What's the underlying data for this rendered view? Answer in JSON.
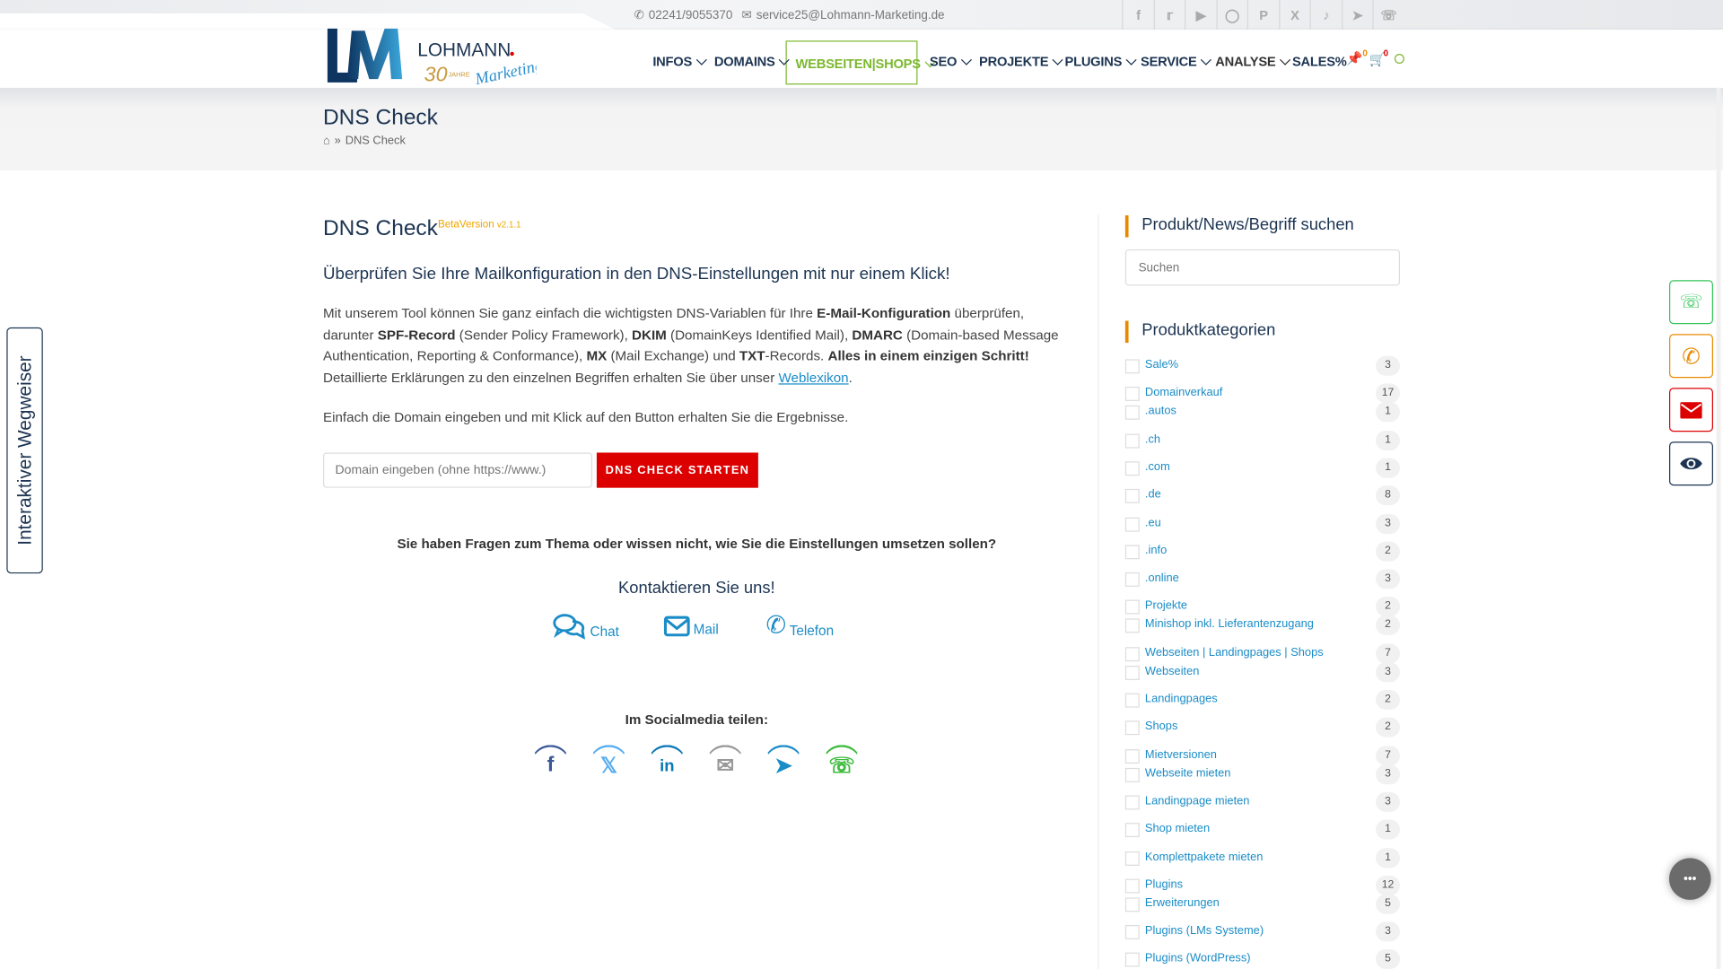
{
  "topbar": {
    "phone": "02241/9055370",
    "email": "service25@Lohmann-Marketing.de",
    "social_icons": [
      "facebook-icon",
      "twitter-icon",
      "youtube-icon",
      "instagram-icon",
      "pinterest-icon",
      "xing-icon",
      "tiktok-icon",
      "telegram-icon",
      "whatsapp-icon"
    ]
  },
  "logo": {
    "text": "LOHMANN.",
    "sub": "30",
    "jahre": "JAHRE",
    "marketing": "Marketing"
  },
  "nav": {
    "items": [
      {
        "label": "INFOS",
        "dropdown": true
      },
      {
        "label": "DOMAINS",
        "dropdown": true
      },
      {
        "label": "WEBSEITEN|SHOPS",
        "dropdown": true,
        "active": true
      },
      {
        "label": "SEO",
        "dropdown": true
      },
      {
        "label": "PROJEKTE",
        "dropdown": true
      },
      {
        "label": "PLUGINS",
        "dropdown": true
      },
      {
        "label": "SERVICE",
        "dropdown": true
      },
      {
        "label": "ANALYSE",
        "dropdown": true
      },
      {
        "label": "SALES%",
        "dropdown": false
      }
    ],
    "pin_count": "0",
    "cart_count": "0"
  },
  "page_header": {
    "title": "DNS Check",
    "breadcrumb_current": "DNS Check"
  },
  "main": {
    "title": "DNS Check",
    "beta": "BetaVersion",
    "version": "v2.1.1",
    "subtitle": "Überprüfen Sie Ihre Mailkonfiguration in den DNS-Einstellungen mit nur einem Klick!",
    "intro": [
      {
        "t": "Mit unserem Tool können Sie ganz einfach die wichtigsten DNS-Variablen für Ihre "
      },
      {
        "t": "E-Mail-Konfiguration",
        "b": true
      },
      {
        "t": " überprüfen, darunter "
      },
      {
        "t": "SPF-Record",
        "b": true
      },
      {
        "t": " (Sender Policy Framework), "
      },
      {
        "t": "DKIM",
        "b": true
      },
      {
        "t": " (DomainKeys Identified Mail), "
      },
      {
        "t": "DMARC",
        "b": true
      },
      {
        "t": " (Domain-based Message Authentication, Reporting & Conformance), "
      },
      {
        "t": "MX",
        "b": true
      },
      {
        "t": " (Mail Exchange) und "
      },
      {
        "t": "TXT",
        "b": true
      },
      {
        "t": "-Records. "
      },
      {
        "t": "Alles in einem einzigen Schritt!",
        "b": true
      }
    ],
    "explain_prefix": "Detaillierte Erklärungen zu den einzelnen Begriffen erhalten Sie über unser ",
    "explain_link": "Weblexikon",
    "explain_suffix": ".",
    "instruction": "Einfach die Domain eingeben und mit Klick auf den Button erhalten Sie die Ergebnisse.",
    "domain_placeholder": "Domain eingeben (ohne https://www.)",
    "domain_value": "",
    "check_button": "DNS CHECK STARTEN",
    "questions": "Sie haben Fragen zum Thema oder wissen nicht, wie Sie die Einstellungen umsetzen sollen?",
    "contact_title": "Kontaktieren Sie uns!",
    "contact": {
      "chat": "Chat",
      "mail": "Mail",
      "phone": "Telefon"
    },
    "share_title": "Im Socialmedia teilen:",
    "share_icons": [
      "facebook-icon",
      "x-icon",
      "linkedin-icon",
      "email-icon",
      "telegram-icon",
      "whatsapp-icon"
    ]
  },
  "sidebar": {
    "search_title": "Produkt/News/Begriff suchen",
    "search_placeholder": "Suchen",
    "categories_title": "Produktkategorien",
    "categories": [
      {
        "label": "Sale%",
        "count": "3"
      },
      {
        "label": "Domainverkauf",
        "count": "17"
      },
      {
        "label": ".autos",
        "count": "1"
      },
      {
        "label": ".ch",
        "count": "1"
      },
      {
        "label": ".com",
        "count": "1"
      },
      {
        "label": ".de",
        "count": "8"
      },
      {
        "label": ".eu",
        "count": "3"
      },
      {
        "label": ".info",
        "count": "2"
      },
      {
        "label": ".online",
        "count": "3"
      },
      {
        "label": "Projekte",
        "count": "2"
      },
      {
        "label": "Minishop inkl. Lieferantenzugang",
        "count": "2"
      },
      {
        "label": "Webseiten | Landingpages | Shops",
        "count": "7"
      },
      {
        "label": "Webseiten",
        "count": "3"
      },
      {
        "label": "Landingpages",
        "count": "2"
      },
      {
        "label": "Shops",
        "count": "2"
      },
      {
        "label": "Mietversionen",
        "count": "7"
      },
      {
        "label": "Webseite mieten",
        "count": "3"
      },
      {
        "label": "Landingpage mieten",
        "count": "3"
      },
      {
        "label": "Shop mieten",
        "count": "1"
      },
      {
        "label": "Komplettpakete mieten",
        "count": "1"
      },
      {
        "label": "Plugins",
        "count": "12"
      },
      {
        "label": "Erweiterungen",
        "count": "5"
      },
      {
        "label": "Plugins (LMs Systeme)",
        "count": "3"
      },
      {
        "label": "Plugins (WordPress)",
        "count": "5"
      }
    ]
  },
  "wegweiser": {
    "label": "Interaktiver Wegweiser"
  },
  "floating_buttons": [
    "whatsapp-icon",
    "phone-icon",
    "email-icon",
    "eye-icon"
  ],
  "colors": {
    "navy": "#1c3452",
    "accent_green": "#7cb82f",
    "orange": "#e88a00",
    "red": "#dd0000",
    "link_blue": "#1a8cc7"
  }
}
